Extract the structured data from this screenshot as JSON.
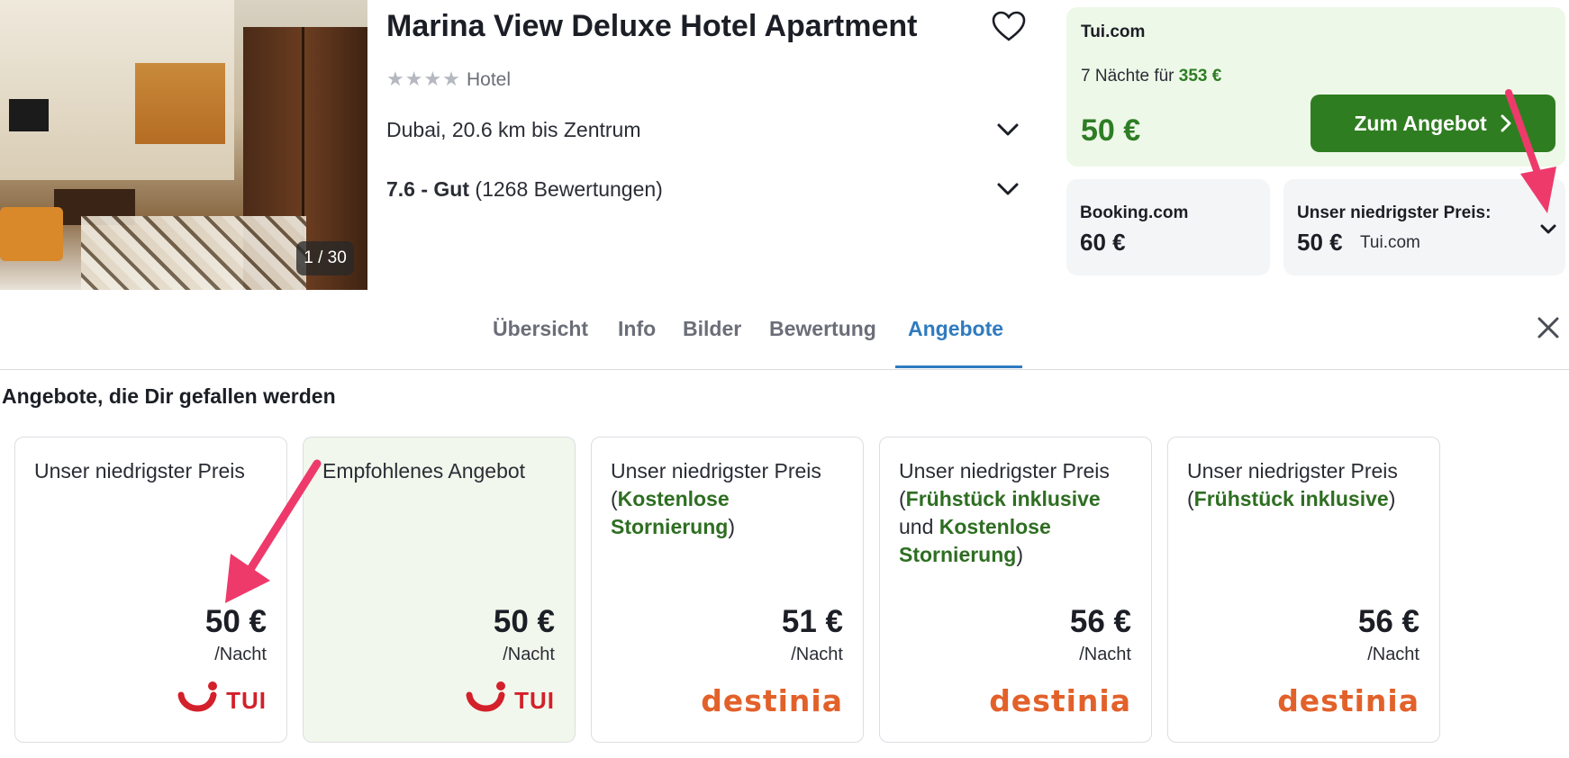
{
  "hotel": {
    "name": "Marina View Deluxe Hotel Apartment",
    "stars": "★★★★",
    "type": "Hotel",
    "location": "Dubai, 20.6 km bis Zentrum",
    "rating_score": "7.6 - Gut",
    "rating_count": "(1268 Bewertungen)",
    "image_counter": "1 / 30"
  },
  "main_offer": {
    "site": "Tui.com",
    "nights_prefix": "7 Nächte für ",
    "nights_total": "353 €",
    "price": "50 €",
    "cta_label": "Zum Angebot"
  },
  "alt_offer": {
    "site": "Booking.com",
    "price": "60 €"
  },
  "lowest": {
    "label": "Unser niedrigster Preis:",
    "price": "50 €",
    "site": "Tui.com"
  },
  "tabs": [
    {
      "label": "Übersicht"
    },
    {
      "label": "Info"
    },
    {
      "label": "Bilder"
    },
    {
      "label": "Bewertung"
    },
    {
      "label": "Angebote"
    }
  ],
  "section_title": "Angebote, die Dir gefallen werden",
  "offers": [
    {
      "title": "Unser niedrigster Preis",
      "price": "50 €",
      "per": "/Nacht",
      "provider": "TUI"
    },
    {
      "title": "Empfohlenes Angebot",
      "price": "50 €",
      "per": "/Nacht",
      "provider": "TUI"
    },
    {
      "title": "Unser niedrigster Preis",
      "open": "(",
      "g1": "Kostenlose Stornierung",
      "close": ")",
      "price": "51 €",
      "per": "/Nacht",
      "provider": "destinia"
    },
    {
      "title": "Unser niedrigster Preis",
      "open": "(",
      "g1": "Frühstück inklusive",
      "mid": "und",
      "g2": "Kostenlose Stornierung",
      "close": ")",
      "price": "56 €",
      "per": "/Nacht",
      "provider": "destinia"
    },
    {
      "title": "Unser niedrigster Preis",
      "open": "(",
      "g1": "Frühstück inklusive",
      "close": ")",
      "price": "56 €",
      "per": "/Nacht",
      "provider": "destinia"
    }
  ],
  "colors": {
    "accent_green": "#2f7d21",
    "active_tab": "#2f7bbf",
    "arrow": "#ee3a6b",
    "tui_red": "#d3202a",
    "destinia_orange": "#e2612a"
  }
}
